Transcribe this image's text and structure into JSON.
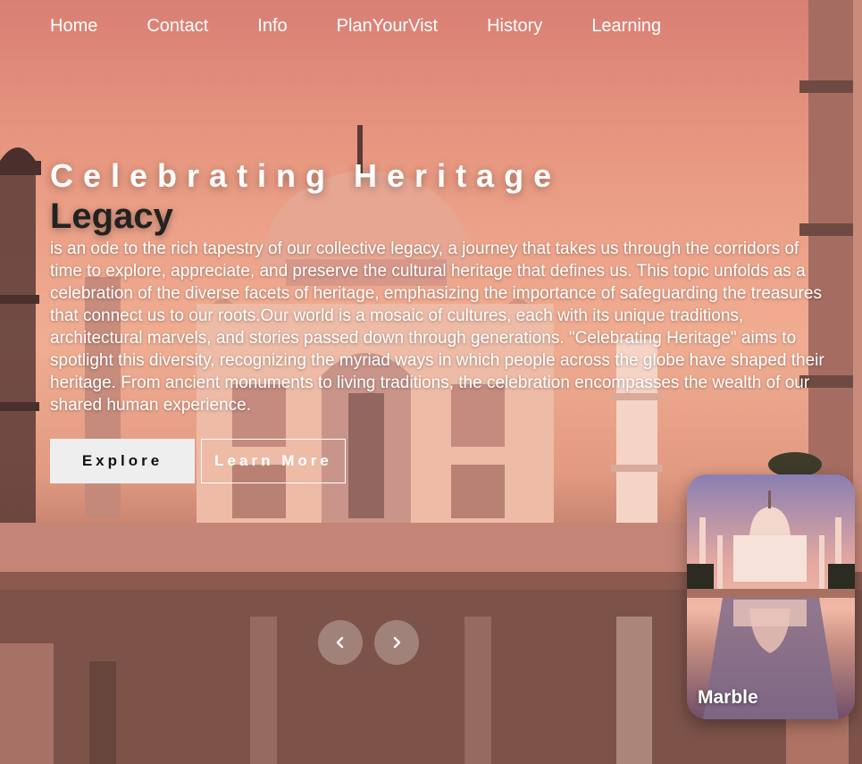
{
  "nav": {
    "items": [
      {
        "label": "Home"
      },
      {
        "label": "Contact"
      },
      {
        "label": "Info"
      },
      {
        "label": "PlanYourVist"
      },
      {
        "label": "History"
      },
      {
        "label": "Learning"
      }
    ]
  },
  "hero": {
    "title": "Celebrating Heritage",
    "subtitle": "Legacy",
    "description": "is an ode to the rich tapestry of our collective legacy, a journey that takes us through the corridors of time to explore, appreciate, and preserve the cultural heritage that defines us. This topic unfolds as a celebration of the diverse facets of heritage, emphasizing the importance of safeguarding the treasures that connect us to our roots.Our world is a mosaic of cultures, each with its unique traditions, architectural marvels, and stories passed down through generations. \"Celebrating Heritage\" aims to spotlight this diversity, recognizing the myriad ways in which people across the globe have shaped their heritage. From ancient monuments to living traditions, the celebration encompasses the wealth of our shared human experience.",
    "explore_label": "Explore",
    "learn_more_label": "Learn More"
  },
  "slider": {
    "prev_icon": "chevron-left-icon",
    "next_icon": "chevron-right-icon"
  },
  "card": {
    "label": "Marble"
  },
  "colors": {
    "sky_top": "#d97f74",
    "sky_mid": "#f0ad92",
    "marble": "#f2c7b4",
    "button_light": "#eeeeee"
  }
}
